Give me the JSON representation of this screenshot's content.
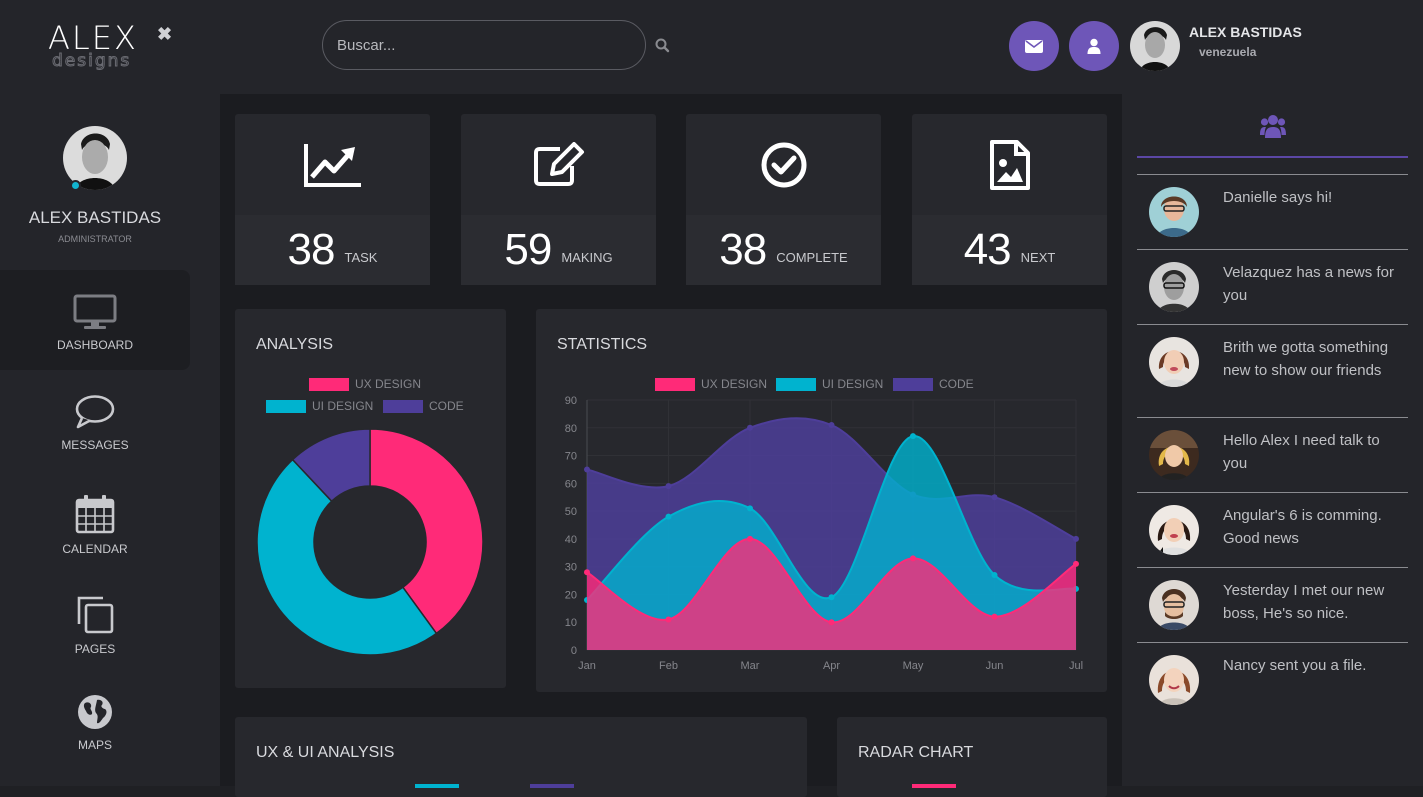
{
  "brand": {
    "logo_main": "ALEX",
    "logo_sub": "designs"
  },
  "search": {
    "placeholder": "Buscar..."
  },
  "user": {
    "name": "ALEX BASTIDAS",
    "country": "venezuela",
    "role": "ADMINISTRATOR"
  },
  "nav": [
    {
      "label": "DASHBOARD",
      "icon": "monitor-icon",
      "active": true
    },
    {
      "label": "MESSAGES",
      "icon": "chat-bubble-icon"
    },
    {
      "label": "CALENDAR",
      "icon": "calendar-icon"
    },
    {
      "label": "PAGES",
      "icon": "pages-icon"
    },
    {
      "label": "MAPS",
      "icon": "globe-icon"
    }
  ],
  "stats": [
    {
      "value": "38",
      "label": "TASK",
      "icon": "chart-line-icon"
    },
    {
      "value": "59",
      "label": "MAKING",
      "icon": "edit-icon"
    },
    {
      "value": "38",
      "label": "COMPLETE",
      "icon": "check-circle-icon"
    },
    {
      "value": "43",
      "label": "NEXT",
      "icon": "image-file-icon"
    }
  ],
  "cards": {
    "analysis": "ANALYSIS",
    "statistics": "STATISTICS",
    "uxui": "UX & UI ANALYSIS",
    "radar": "RADAR CHART"
  },
  "colors": {
    "ux": "#ff2a78",
    "ui": "#00b3cf",
    "code": "#4e3e9a",
    "accent": "#6e56b8"
  },
  "chart_data": [
    {
      "type": "pie",
      "title": "ANALYSIS",
      "categories": [
        "UX DESIGN",
        "UI DESIGN",
        "CODE"
      ],
      "values": [
        40,
        48,
        12
      ]
    },
    {
      "type": "area",
      "title": "STATISTICS",
      "categories": [
        "Jan",
        "Feb",
        "Mar",
        "Apr",
        "May",
        "Jun",
        "Jul"
      ],
      "ylim": [
        0,
        90
      ],
      "yticks": [
        0,
        10,
        20,
        30,
        40,
        50,
        60,
        70,
        80,
        90
      ],
      "grid": true,
      "legend": "top",
      "series": [
        {
          "name": "UX DESIGN",
          "values": [
            28,
            11,
            40,
            10,
            33,
            12,
            31
          ]
        },
        {
          "name": "UI DESIGN",
          "values": [
            18,
            48,
            51,
            19,
            77,
            27,
            22
          ]
        },
        {
          "name": "CODE",
          "values": [
            65,
            59,
            80,
            81,
            56,
            55,
            40
          ]
        }
      ]
    }
  ],
  "messages": [
    {
      "text": "Danielle says hi!"
    },
    {
      "text": "Velazquez has a news for you"
    },
    {
      "text": "Brith we gotta something new to show our friends"
    },
    {
      "text": "Hello Alex I need talk to you"
    },
    {
      "text": "Angular's 6 is comming. Good news"
    },
    {
      "text": "Yesterday I met our new boss, He's so nice."
    },
    {
      "text": "Nancy sent you a file."
    }
  ]
}
